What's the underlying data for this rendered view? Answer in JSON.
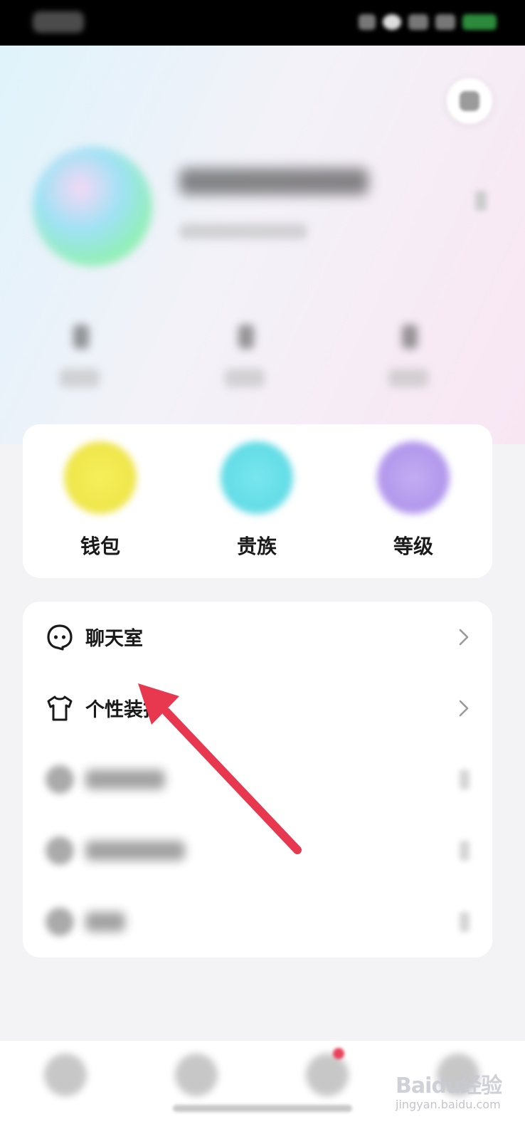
{
  "features": [
    {
      "label": "钱包",
      "color": "#f2ea52"
    },
    {
      "label": "贵族",
      "color": "#6fe2ea"
    },
    {
      "label": "等级",
      "color": "#b9a0ef"
    }
  ],
  "menu": {
    "items": [
      {
        "label": "聊天室",
        "icon": "ghost-chat-icon"
      },
      {
        "label": "个性装扮",
        "icon": "tshirt-icon"
      }
    ]
  },
  "annotation": {
    "arrow_color": "#e8384f"
  },
  "watermark": {
    "brand": "Baidu经验",
    "sub": "jingyan.baidu.com"
  }
}
